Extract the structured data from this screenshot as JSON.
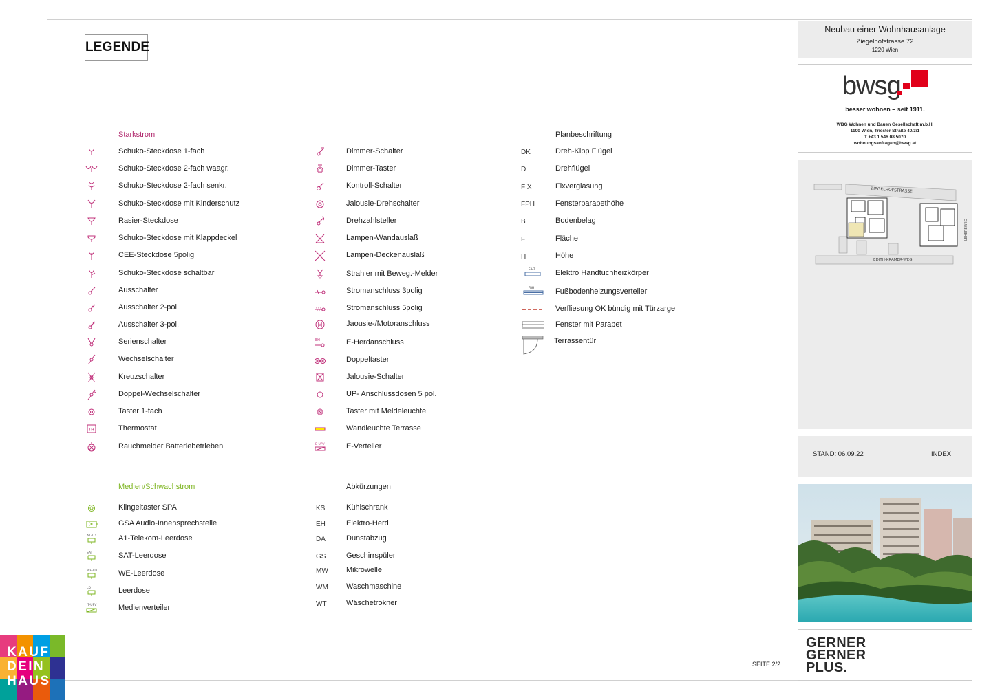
{
  "legend_title": "LEGENDE",
  "starkstrom": {
    "title": "Starkstrom",
    "items": [
      {
        "sym": "schuko-1-icon",
        "label": "Schuko-Steckdose 1-fach"
      },
      {
        "sym": "schuko-2-waagr-icon",
        "label": "Schuko-Steckdose 2-fach waagr."
      },
      {
        "sym": "schuko-2-senkr-icon",
        "label": "Schuko-Steckdose 2-fach senkr."
      },
      {
        "sym": "schuko-kinderschutz-icon",
        "label": "Schuko-Steckdose mit Kinderschutz"
      },
      {
        "sym": "rasier-icon",
        "label": "Rasier-Steckdose"
      },
      {
        "sym": "klappdeckel-icon",
        "label": "Schuko-Steckdose mit Klappdeckel"
      },
      {
        "sym": "cee-icon",
        "label": "CEE-Steckdose 5polig"
      },
      {
        "sym": "schaltbar-icon",
        "label": "Schuko-Steckdose schaltbar"
      },
      {
        "sym": "ausschalter-icon",
        "label": "Ausschalter"
      },
      {
        "sym": "ausschalter-2pol-icon",
        "label": "Ausschalter 2-pol."
      },
      {
        "sym": "ausschalter-3pol-icon",
        "label": "Ausschalter 3-pol."
      },
      {
        "sym": "serienschalter-icon",
        "label": "Serienschalter"
      },
      {
        "sym": "wechselschalter-icon",
        "label": "Wechselschalter"
      },
      {
        "sym": "kreuzschalter-icon",
        "label": "Kreuzschalter"
      },
      {
        "sym": "doppel-wechselschalter-icon",
        "label": "Doppel-Wechselschalter"
      },
      {
        "sym": "taster-icon",
        "label": "Taster 1-fach"
      },
      {
        "sym": "thermostat-icon",
        "label": "Thermostat"
      },
      {
        "sym": "rauchmelder-icon",
        "label": "Rauchmelder Batteriebetrieben"
      }
    ]
  },
  "mid": {
    "items": [
      {
        "sym": "dimmer-schalter-icon",
        "label": "Dimmer-Schalter"
      },
      {
        "sym": "dimmer-taster-icon",
        "label": "Dimmer-Taster"
      },
      {
        "sym": "kontroll-schalter-icon",
        "label": "Kontroll-Schalter"
      },
      {
        "sym": "jalousie-drehschalter-icon",
        "label": "Jalousie-Drehschalter"
      },
      {
        "sym": "drehzahlsteller-icon",
        "label": "Drehzahlsteller"
      },
      {
        "sym": "lampen-wand-icon",
        "label": "Lampen-Wandauslaß"
      },
      {
        "sym": "lampen-decke-icon",
        "label": "Lampen-Deckenauslaß"
      },
      {
        "sym": "strahler-icon",
        "label": "Strahler mit Beweg.-Melder"
      },
      {
        "sym": "strom-3polig-icon",
        "label": "Stromanschluss 3polig"
      },
      {
        "sym": "strom-5polig-icon",
        "label": "Stromanschluss 5polig"
      },
      {
        "sym": "motor-icon",
        "label": "Jaousie-/Motoranschluss"
      },
      {
        "sym": "e-herd-icon",
        "label": "E-Herdanschluss"
      },
      {
        "sym": "doppeltaster-icon",
        "label": "Doppeltaster"
      },
      {
        "sym": "jalousie-schalter-icon",
        "label": "Jalousie-Schalter"
      },
      {
        "sym": "up-anschluss-icon",
        "label": "UP- Anschlussdosen 5 pol."
      },
      {
        "sym": "taster-meldeleuchte-icon",
        "label": "Taster mit Meldeleuchte"
      },
      {
        "sym": "wandleuchte-icon",
        "label": "Wandleuchte Terrasse"
      },
      {
        "sym": "e-verteiler-icon",
        "label": "E-Verteiler"
      }
    ]
  },
  "plan": {
    "title": "Planbeschriftung",
    "items": [
      {
        "abbr": "DK",
        "label": "Dreh-Kipp Flügel"
      },
      {
        "abbr": "D",
        "label": "Drehflügel"
      },
      {
        "abbr": "FIX",
        "label": "Fixverglasung"
      },
      {
        "abbr": "FPH",
        "label": "Fensterparapethöhe"
      },
      {
        "abbr": "B",
        "label": "Bodenbelag"
      },
      {
        "abbr": "F",
        "label": "Fläche"
      },
      {
        "abbr": "H",
        "label": "Höhe"
      },
      {
        "abbr": "",
        "sym": "e-hz-icon",
        "sym_text": "E-HZ",
        "label": "Elektro Handtuchheizkörper"
      },
      {
        "abbr": "",
        "sym": "fbh-icon",
        "sym_text": "FBH",
        "label": "Fußbodenheizungsverteiler"
      },
      {
        "abbr": "",
        "sym": "dashed-line-icon",
        "label": "Verfliesung OK bündig mit Türzarge"
      },
      {
        "abbr": "",
        "sym": "fenster-parapet-icon",
        "label": "Fenster mit Parapet"
      },
      {
        "abbr": "",
        "sym": "terrassentuer-icon",
        "label": "Terrassentür"
      }
    ]
  },
  "medien": {
    "title": "Medien/Schwachstrom",
    "items": [
      {
        "sym": "klingeltaster-icon",
        "label": "Klingeltaster SPA"
      },
      {
        "sym": "gsa-icon",
        "label": "GSA Audio-Innensprechstelle"
      },
      {
        "sym": "a1-icon",
        "sym_text": "A1-LD",
        "label": "A1-Telekom-Leerdose"
      },
      {
        "sym": "sat-icon",
        "sym_text": "SAT",
        "label": "SAT-Leerdose"
      },
      {
        "sym": "we-icon",
        "sym_text": "WE-LD",
        "label": "WE-Leerdose"
      },
      {
        "sym": "leerdose-icon",
        "sym_text": "LD",
        "label": "Leerdose"
      },
      {
        "sym": "medienverteiler-icon",
        "sym_text": "IT-UPV",
        "label": "Medienverteiler"
      }
    ]
  },
  "abk": {
    "title": "Abkürzungen",
    "items": [
      {
        "abbr": "KS",
        "label": "Kühlschrank"
      },
      {
        "abbr": "EH",
        "label": "Elektro-Herd"
      },
      {
        "abbr": "DA",
        "label": "Dunstabzug"
      },
      {
        "abbr": "GS",
        "label": "Geschirrspüler"
      },
      {
        "abbr": "MW",
        "label": "Mikrowelle"
      },
      {
        "abbr": "WM",
        "label": "Waschmaschine"
      },
      {
        "abbr": "WT",
        "label": "Wäschetrokner"
      }
    ]
  },
  "project": {
    "title": "Neubau einer Wohnhausanlage",
    "street": "Ziegelhofstrasse 72",
    "city": "1220 Wien"
  },
  "bwsg": {
    "logo": "bwsg",
    "tagline": "besser wohnen – seit 1911.",
    "addr": [
      "WBG Wohnen und Bauen Gesellschaft m.b.H.",
      "1100 Wien, Triester Straße 40/3/1",
      "T +43 1 546 08 5070",
      "wohnungsanfragen@bwsg.at"
    ]
  },
  "map": {
    "street_top": "ZIEGELHOFSTRASSE",
    "street_bottom": "EDITH-KRAMER-WEG",
    "street_right": "LEHERBWEG"
  },
  "stand": {
    "label": "STAND: 06.09.22",
    "index": "INDEX"
  },
  "seite": "SEITE 2/2",
  "gerner": [
    "GERNER",
    "GERNER",
    "PLUS."
  ],
  "kauf": [
    "KAUF",
    "DEIN",
    "HAUS"
  ],
  "colors": {
    "starkstrom": "#b0256b",
    "medien": "#7db520",
    "symbol": "#c0307a"
  }
}
